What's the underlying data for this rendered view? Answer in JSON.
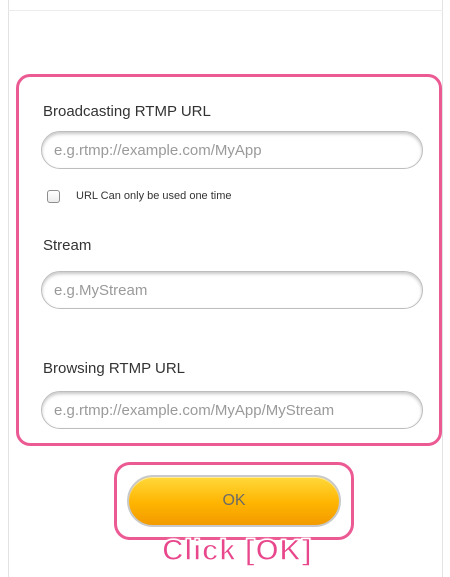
{
  "form": {
    "broadcast_url": {
      "label": "Broadcasting RTMP URL",
      "placeholder": "e.g.rtmp://example.com/MyApp",
      "value": ""
    },
    "one_time_checkbox": {
      "label": "URL Can only be used one time",
      "checked": false
    },
    "stream": {
      "label": "Stream",
      "placeholder": "e.g.MyStream",
      "value": ""
    },
    "browsing_url": {
      "label": "Browsing RTMP URL",
      "placeholder": "e.g.rtmp://example.com/MyApp/MyStream",
      "value": ""
    }
  },
  "actions": {
    "ok_label": "OK"
  },
  "annotation": {
    "instruction": "Click [OK]"
  },
  "colors": {
    "highlight": "#ec5a94",
    "button_top": "#ffd93a",
    "button_bottom": "#f29a00",
    "instruction_text": "#e8478c"
  }
}
